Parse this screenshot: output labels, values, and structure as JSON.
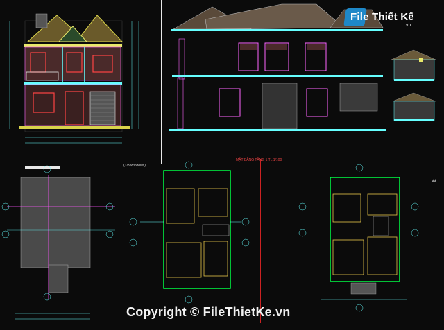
{
  "logo": {
    "brand": "File Thiết Kế",
    "domain": ".vn"
  },
  "watermark": "Copyright © FileThietKe.vn",
  "labels": {
    "plan_note": "(1/3 Windows)",
    "section_title": "MẶT BẰNG TẦNG 1 TL 1/100",
    "axes": [
      "A",
      "B",
      "C",
      "D"
    ],
    "axis_c": "C",
    "north": "W"
  },
  "colors": {
    "background": "#0b0b0b",
    "lines": "#e8e8e8",
    "brand": "#1e88c8"
  }
}
